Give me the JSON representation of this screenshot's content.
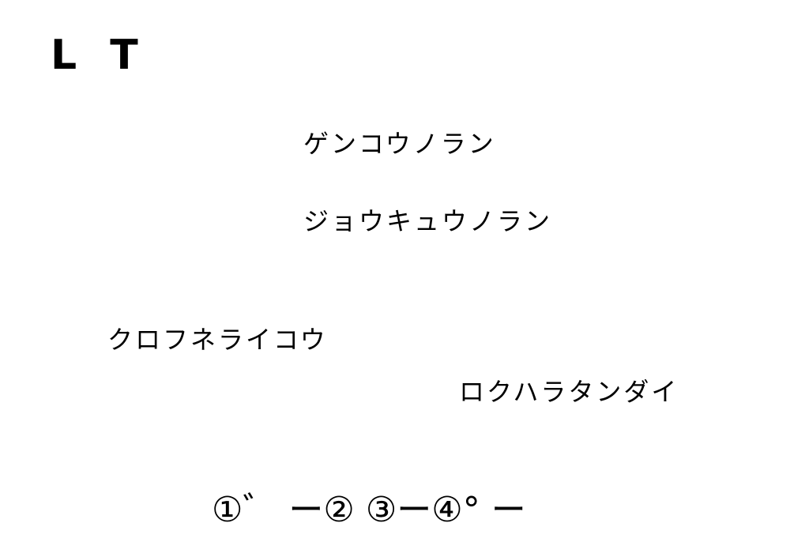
{
  "title": "L T",
  "items": [
    "ゲンコウノラン",
    "ジョウキュウノラン",
    "クロフネライコウ",
    "ロクハラタンダイ"
  ],
  "sequence": "①゛ ー② ③ー④° ー"
}
